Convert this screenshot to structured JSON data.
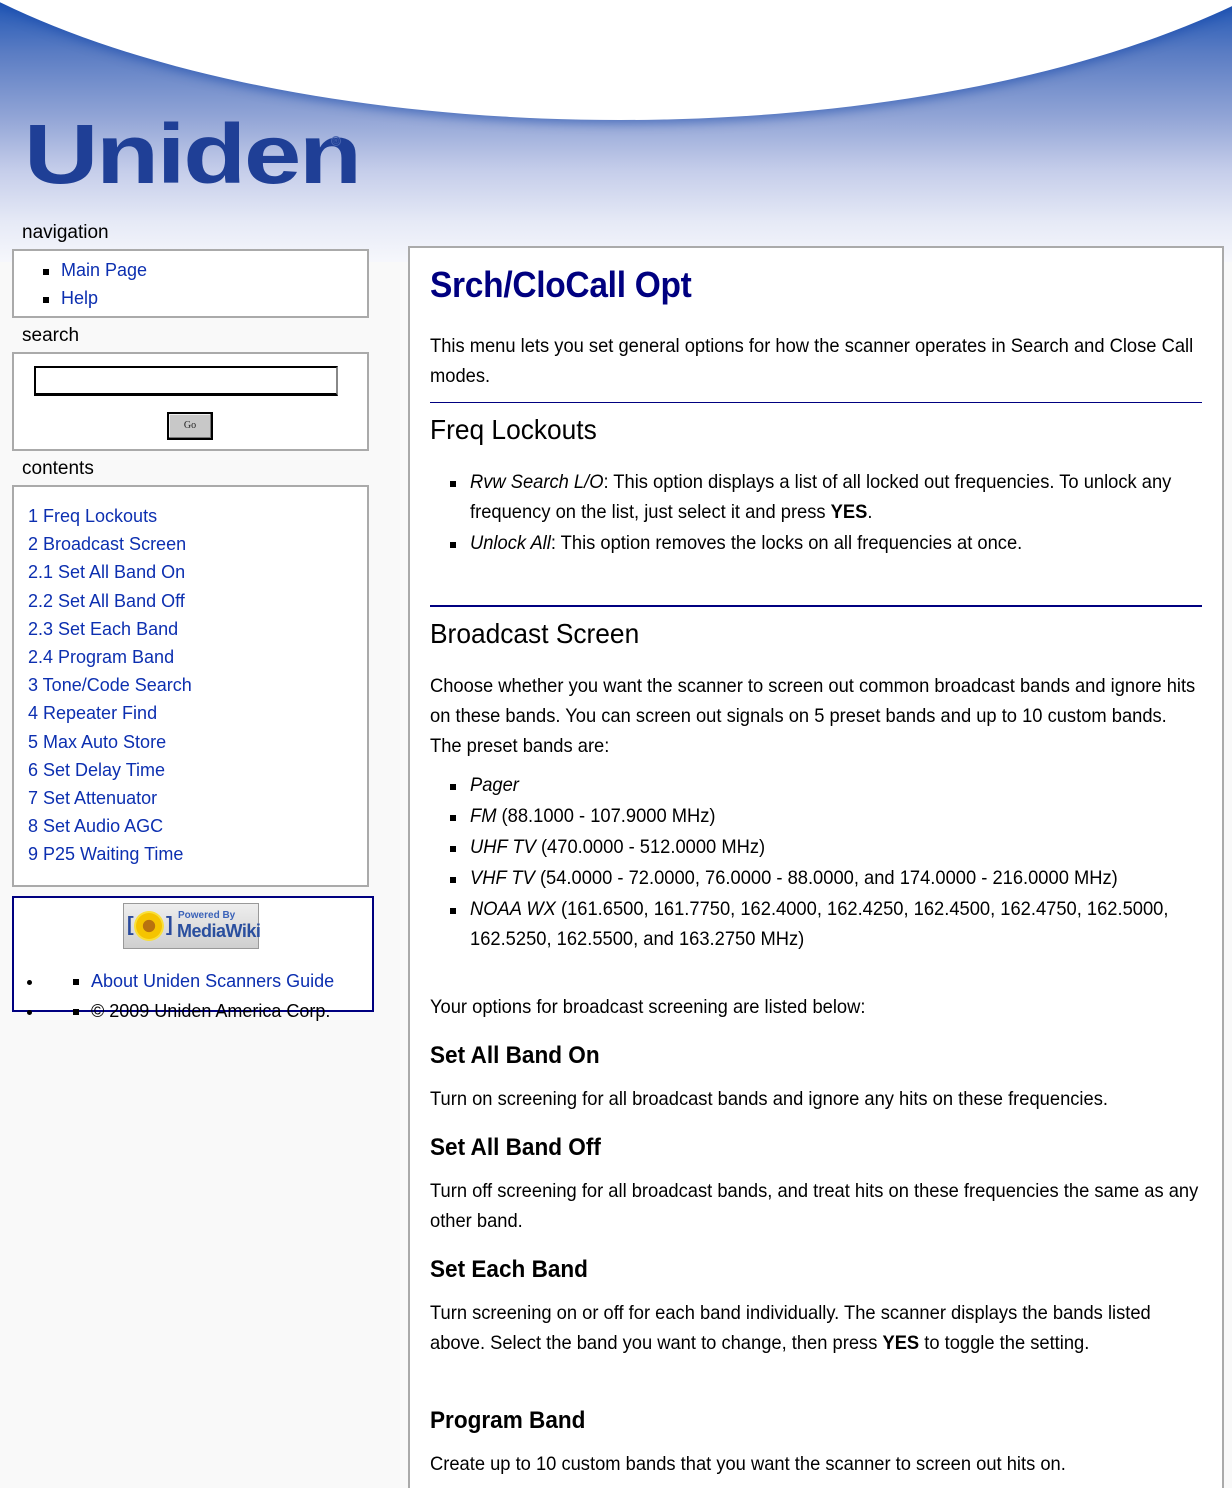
{
  "header": {
    "logo_text": "Uniden",
    "logo_registered": "®"
  },
  "sidebar": {
    "navigation": {
      "title": "navigation",
      "items": [
        {
          "label": "Main Page"
        },
        {
          "label": "Help"
        }
      ]
    },
    "search": {
      "title": "search",
      "input_value": "",
      "go_label": "Go"
    },
    "contents": {
      "title": "contents",
      "items": [
        {
          "label": "1 Freq Lockouts"
        },
        {
          "label": "2 Broadcast Screen"
        },
        {
          "label": "2.1 Set All Band On"
        },
        {
          "label": "2.2 Set All Band Off"
        },
        {
          "label": "2.3 Set Each Band"
        },
        {
          "label": "2.4 Program Band"
        },
        {
          "label": "3 Tone/Code Search"
        },
        {
          "label": "4 Repeater Find"
        },
        {
          "label": "5 Max Auto Store"
        },
        {
          "label": "6 Set Delay Time"
        },
        {
          "label": "7 Set Attenuator"
        },
        {
          "label": "8 Set Audio AGC"
        },
        {
          "label": "9 P25 Waiting Time"
        }
      ]
    },
    "footer": {
      "badge": {
        "bracket_left": "[",
        "bracket_right": "]",
        "line1": "Powered By",
        "line2": "MediaWiki"
      },
      "about_link": "About Uniden Scanners Guide",
      "copyright": "© 2009 Uniden America Corp."
    }
  },
  "content": {
    "title": "Srch/CloCall Opt",
    "intro": "This menu lets you set general options for how the scanner operates in Search and Close Call modes.",
    "freq_lockouts": {
      "heading": "Freq Lockouts",
      "items": [
        {
          "term": "Rvw Search L/O",
          "text_a": ": This option displays a list of all locked out frequencies. To unlock any frequency on the list, just select it and press ",
          "bold": "YES",
          "text_b": "."
        },
        {
          "term": "Unlock All",
          "text_a": ": This option removes the locks on all frequencies at once."
        }
      ]
    },
    "broadcast_screen": {
      "heading": "Broadcast Screen",
      "intro": "Choose whether you want the scanner to screen out common broadcast bands and ignore hits on these bands. You can screen out signals on 5 preset bands and up to 10 custom bands. The preset bands are:",
      "bands": [
        {
          "name": "Pager",
          "range": ""
        },
        {
          "name": "FM",
          "range": " (88.1000 - 107.9000 MHz)"
        },
        {
          "name": "UHF TV",
          "range": " (470.0000 - 512.0000 MHz)"
        },
        {
          "name": "VHF TV",
          "range": " (54.0000 - 72.0000, 76.0000 - 88.0000, and 174.0000 - 216.0000 MHz)"
        },
        {
          "name": "NOAA WX",
          "range": " (161.6500, 161.7750, 162.4000, 162.4250, 162.4500, 162.4750, 162.5000, 162.5250, 162.5500, and 163.2750 MHz)"
        }
      ],
      "options_intro": "Your options for broadcast screening are listed below:",
      "set_all_on": {
        "heading": "Set All Band On",
        "text": "Turn on screening for all broadcast bands and ignore any hits on these frequencies."
      },
      "set_all_off": {
        "heading": "Set All Band Off",
        "text": "Turn off screening for all broadcast bands, and treat hits on these frequencies the same as any other band."
      },
      "set_each": {
        "heading": "Set Each Band",
        "text_a": "Turn screening on or off for each band individually. The scanner displays the bands listed above. Select the band you want to change, then press ",
        "bold": "YES",
        "text_b": " to toggle the setting."
      },
      "program_band": {
        "heading": "Program Band",
        "text": "Create up to 10 custom bands that you want the scanner to screen out hits on."
      }
    }
  },
  "colors": {
    "title": "#000080",
    "link": "#0c2fb0",
    "rule": "#000080",
    "logo": "#1f3f96",
    "box_border": "#aaaaaa"
  }
}
